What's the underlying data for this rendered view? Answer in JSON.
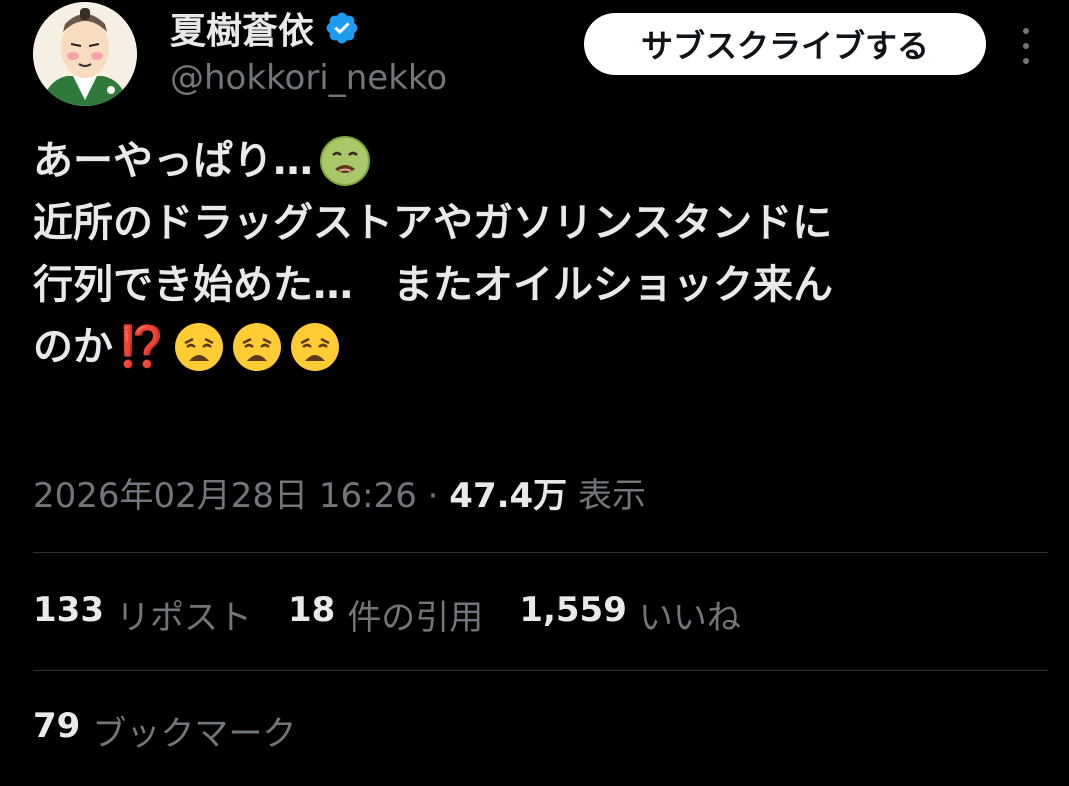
{
  "author": {
    "display_name": "夏樹蒼依",
    "handle": "@hokkori_nekko",
    "verified": true,
    "avatar_icon": "samurai-avatar-icon"
  },
  "subscribe_label": "サブスクライブする",
  "tweet": {
    "lines": [
      "あーやっぱり…",
      "近所のドラッグストアやガソリンスタンドに",
      "行列でき始めた…　またオイルショック来ん",
      "のか"
    ],
    "emojis": {
      "line1": "nauseated-face-emoji",
      "line4": [
        "interrobang-emoji",
        "weary-face-emoji",
        "weary-face-emoji",
        "weary-face-emoji"
      ]
    },
    "interrobang": "⁉️"
  },
  "meta": {
    "timestamp": "2026年02月28日 16:26",
    "separator": " · ",
    "views_count": "47.4万",
    "views_label": "表示"
  },
  "stats": {
    "reposts_count": "133",
    "reposts_label": "リポスト",
    "quotes_count": "18",
    "quotes_label": "件の引用",
    "likes_count": "1,559",
    "likes_label": "いいね"
  },
  "bookmarks": {
    "count": "79",
    "label": "ブックマーク"
  },
  "colors": {
    "background": "#000000",
    "text_primary": "#e7e9ea",
    "text_secondary": "#71767b",
    "divider": "#2f3336",
    "verified_blue": "#1d9bf0",
    "interrobang_red": "#f4212e"
  }
}
